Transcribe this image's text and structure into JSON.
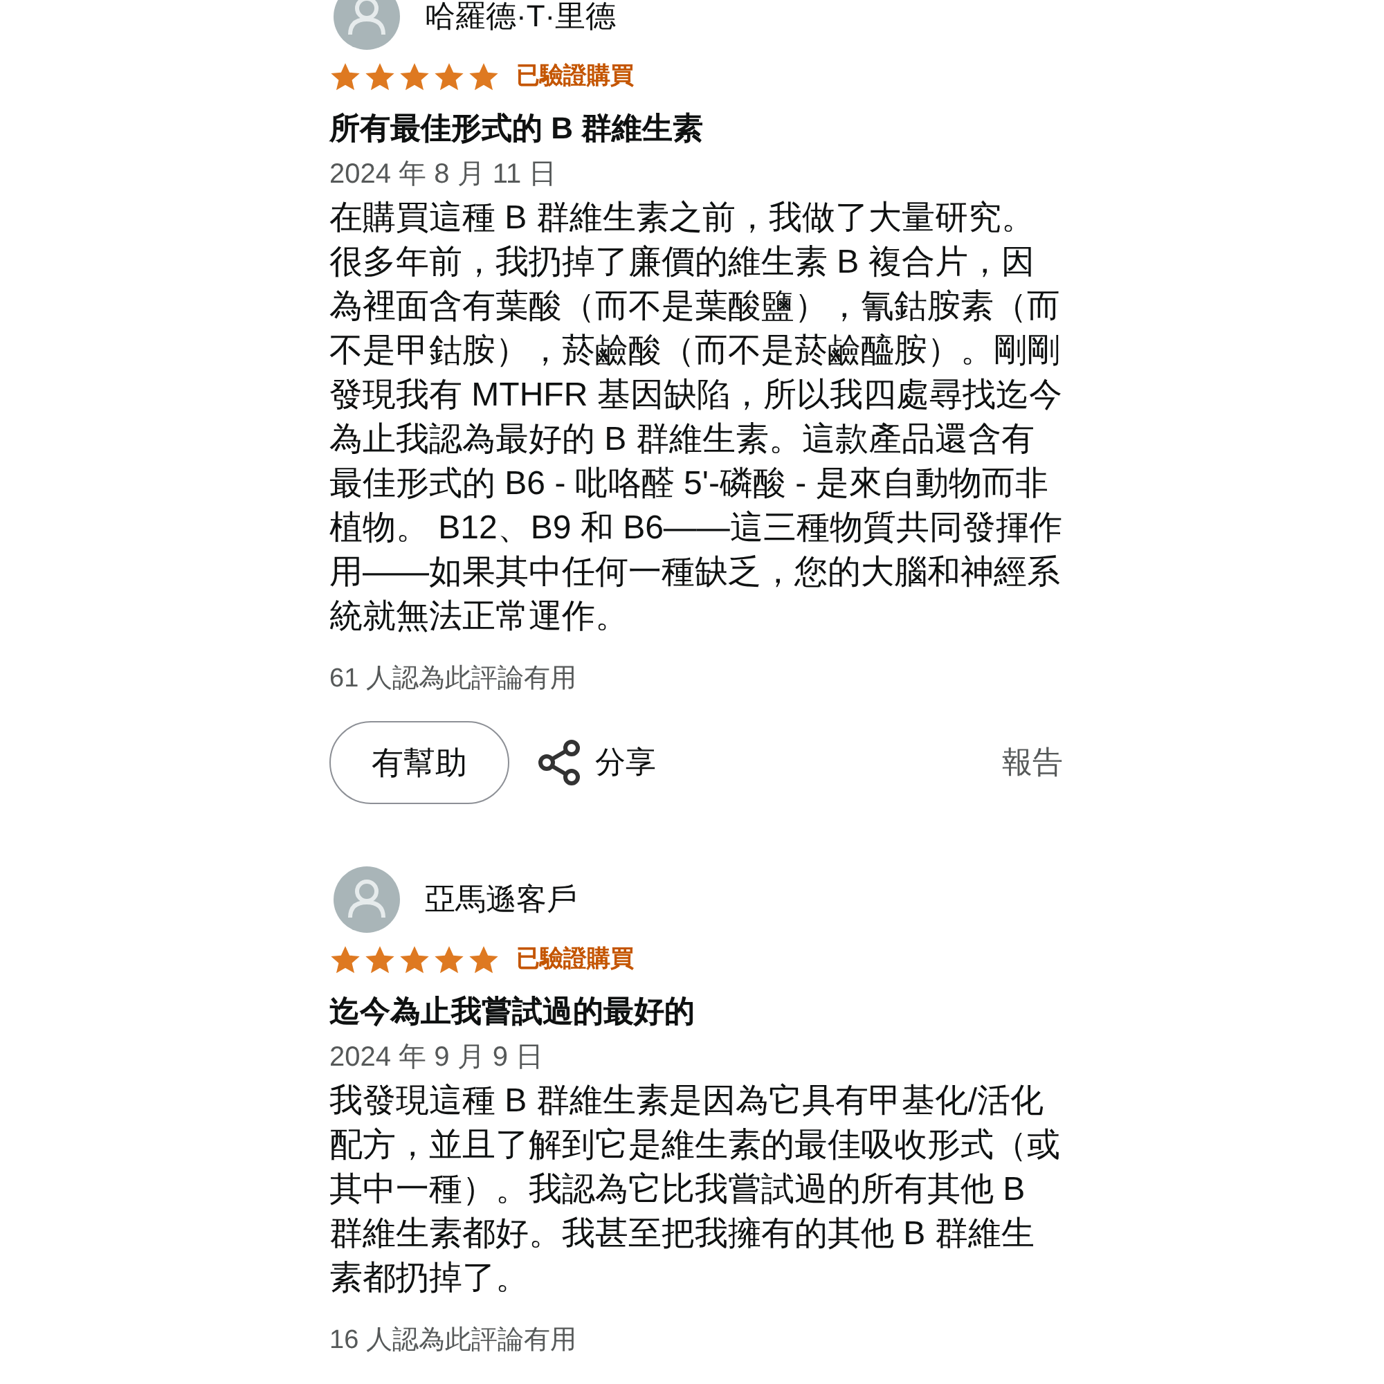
{
  "reviews": [
    {
      "author": "哈羅德·T·里德",
      "stars": 5,
      "badge": "已驗證購買",
      "title": "所有最佳形式的 B 群維生素",
      "date": "2024 年 8 月 11 日",
      "body": "在購買這種 B 群維生素之前，我做了大量研究。很多年前，我扔掉了廉價的維生素 B 複合片，因為裡面含有葉酸（而不是葉酸鹽），氰鈷胺素（而不是甲鈷胺），菸鹼酸（而不是菸鹼醯胺）。剛剛發現我有 MTHFR 基因缺陷，所以我四處尋找迄今為止我認為最好的 B 群維生素。這款產品還含有最佳形式的 B6 - 吡咯醛 5'-磷酸 - 是來自動物而非植物。 B12、B9 和 B6——這三種物質共同發揮作用——如果其中任何一種缺乏，您的大腦和神經系統就無法正常運作。",
      "helpful_count": "61 人認為此評論有用",
      "actions": {
        "helpful": "有幫助",
        "share": "分享",
        "report": "報告"
      }
    },
    {
      "author": "亞馬遜客戶",
      "stars": 5,
      "badge": "已驗證購買",
      "title": "迄今為止我嘗試過的最好的",
      "date": "2024 年 9 月 9 日",
      "body": "我發現這種 B 群維生素是因為它具有甲基化/活化配方，並且了解到它是維生素的最佳吸收形式（或其中一種）。我認為它比我嘗試過的所有其他 B 群維生素都好。我甚至把我擁有的其他 B 群維生素都扔掉了。",
      "helpful_count": "16 人認為此評論有用"
    }
  ]
}
